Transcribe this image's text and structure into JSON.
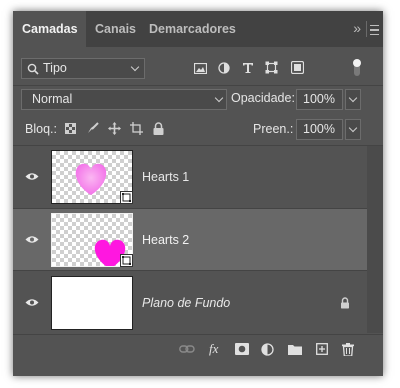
{
  "tabs": [
    {
      "label": "Camadas",
      "active": true
    },
    {
      "label": "Canais",
      "active": false
    },
    {
      "label": "Demarcadores",
      "active": false
    }
  ],
  "tabbar_collapse": "»",
  "filter": {
    "icon": "search-icon",
    "kind": "Tipo",
    "filter_icons": [
      "image-filter-icon",
      "adjustment-filter-icon",
      "type-filter-icon",
      "shape-filter-icon",
      "smart-object-filter-icon"
    ]
  },
  "blend": {
    "mode": "Normal",
    "opacity_label": "Opacidade:",
    "opacity_value": "100%"
  },
  "lock": {
    "label": "Bloq.:",
    "fill_label": "Preen.:",
    "fill_value": "100%",
    "icons": [
      "lock-transparent-icon",
      "lock-pixels-icon",
      "lock-position-icon",
      "lock-artboard-icon",
      "lock-all-icon"
    ]
  },
  "layers": [
    {
      "name": "Hearts 1",
      "visible": true,
      "selected": false,
      "kind": "smart-object"
    },
    {
      "name": "Hearts 2",
      "visible": true,
      "selected": true,
      "kind": "smart-object"
    },
    {
      "name": "Plano de Fundo",
      "visible": true,
      "selected": false,
      "kind": "background",
      "locked": true
    }
  ],
  "bottom_toolbar": {
    "fx_label": "fx",
    "icons": [
      "link-layers-icon",
      "fx-icon",
      "layer-mask-icon",
      "adjustment-layer-icon",
      "group-folder-icon",
      "new-layer-icon",
      "trash-icon"
    ]
  },
  "colors": {
    "panel": "#535353",
    "tabbar": "#424242",
    "selected_row": "#686868",
    "heart_1": "#f26de8",
    "heart_2": "#ff17e0"
  }
}
